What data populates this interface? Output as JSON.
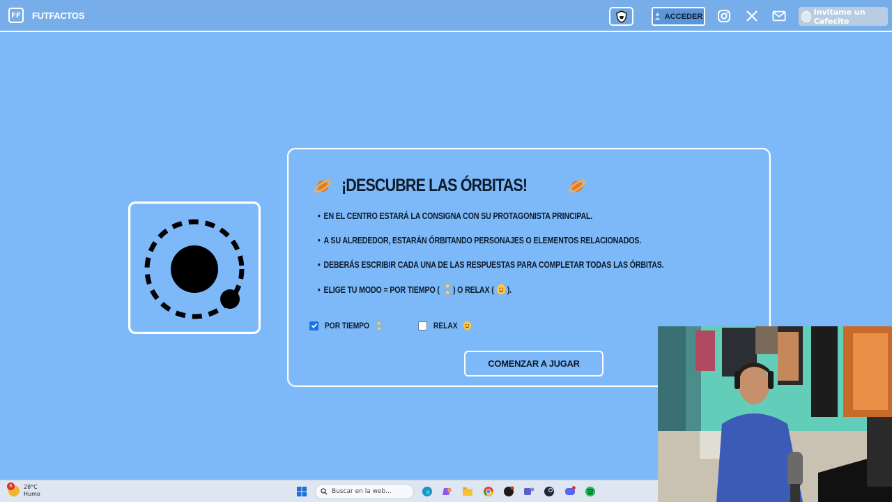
{
  "nav": {
    "brand_logo": "FF",
    "brand_name": "FUTFACTOS",
    "login_label": "ACCEDER",
    "cafecito_label": "Invitame un Cafecito"
  },
  "card": {
    "title": "¡DESCUBRE LAS ÓRBITAS!",
    "rules": [
      "EN EL CENTRO ESTARÁ LA CONSIGNA CON SU PROTAGONISTA PRINCIPAL.",
      "A SU ALREDEDOR, ESTARÁN ÓRBITANDO PERSONAJES O ELEMENTOS RELACIONADOS.",
      "DEBERÁS ESCRIBIR CADA UNA DE LAS RESPUESTAS PARA COMPLETAR TODAS LAS ÓRBITAS."
    ],
    "mode_rule": {
      "prefix": "ELIGE TU MODO = POR TIEMPO (",
      "middle": ") O RELAX (",
      "suffix": ")."
    },
    "options": {
      "timed_label": "POR TIEMPO",
      "timed_checked": true,
      "relax_label": "RELAX",
      "relax_checked": false
    },
    "start_label": "COMENZAR A JUGAR"
  },
  "taskbar": {
    "weather_badge": "6",
    "temperature": "28°C",
    "condition": "Humo",
    "search_placeholder": "Buscar en la web..."
  },
  "colors": {
    "background": "#7db9f8",
    "nav": "#77aee9",
    "accent_checkbox": "#1a73e8"
  }
}
